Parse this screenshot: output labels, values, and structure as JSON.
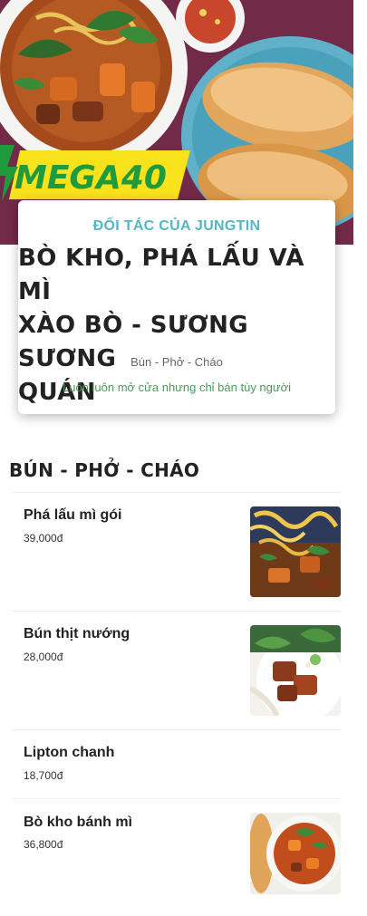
{
  "hero": {
    "promo_text": "MEGA40"
  },
  "store": {
    "partner_label": "ĐỐI TÁC CỦA JUNGTIN",
    "title_lines": [
      "BÒ KHO, PHÁ LẤU VÀ MÌ",
      "XÀO BÒ - SƯƠNG SƯƠNG",
      "QUÁN"
    ],
    "cuisine": "Bún - Phở - Cháo",
    "status": "Luôn luôn mở cửa nhưng chỉ bán tùy người"
  },
  "menu": {
    "section_title": "BÚN - PHỞ - CHÁO",
    "items": [
      {
        "name": "Phá lấu mì gói",
        "price": "39,000đ"
      },
      {
        "name": "Bún thịt nướng",
        "price": "28,000đ"
      },
      {
        "name": "Lipton chanh",
        "price": "18,700đ"
      },
      {
        "name": "Bò kho bánh mì",
        "price": "36,800đ"
      }
    ]
  }
}
